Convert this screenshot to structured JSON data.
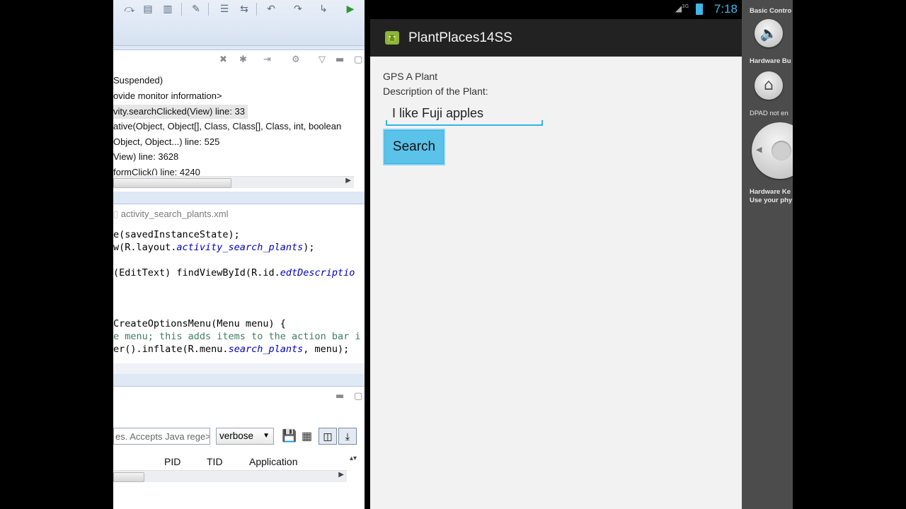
{
  "eclipse": {
    "debug": {
      "lines": [
        "Suspended)",
        "ovide monitor information>",
        "vity.searchClicked(View) line: 33",
        "ative(Object, Object[], Class, Class[], Class, int, boolean",
        "Object, Object...) line: 525",
        "View) line: 3628",
        "formClick() line: 4240"
      ]
    },
    "editor": {
      "tab_label": "activity_search_plants.xml",
      "lines": [
        {
          "pre": "e(savedInstanceState);",
          "it": "",
          "post": ""
        },
        {
          "pre": "w(R.layout.",
          "it": "activity_search_plants",
          "post": ");"
        },
        {
          "pre": " (EditText) findViewById(R.id.",
          "it": "edtDescriptio",
          "post": ""
        },
        {
          "pre": "CreateOptionsMenu(Menu menu) {",
          "it": "",
          "post": ""
        },
        {
          "comment": "e menu; this adds items to the action bar i"
        },
        {
          "pre": "er().inflate(R.menu.",
          "it": "search_plants",
          "post": ", menu);"
        }
      ]
    },
    "logcat": {
      "filter_placeholder": "es. Accepts Java rege>",
      "level_selected": "verbose",
      "columns": [
        "PID",
        "TID",
        "Application"
      ]
    }
  },
  "android": {
    "status": {
      "time": "7:18",
      "network": "3G"
    },
    "app_title": "PlantPlaces14SS",
    "label_gps": "GPS A Plant",
    "label_description": "Description of the Plant:",
    "description_value": "I like Fuji apples",
    "search_button": "Search",
    "accent_color": "#33b5e5"
  },
  "emulator_controls": {
    "basic_controls": "Basic Contro",
    "hardware_buttons": "Hardware Bu",
    "dpad": "DPAD not en",
    "hardware_keyboard": "Hardware Ke",
    "use_physical": "Use your phy"
  }
}
